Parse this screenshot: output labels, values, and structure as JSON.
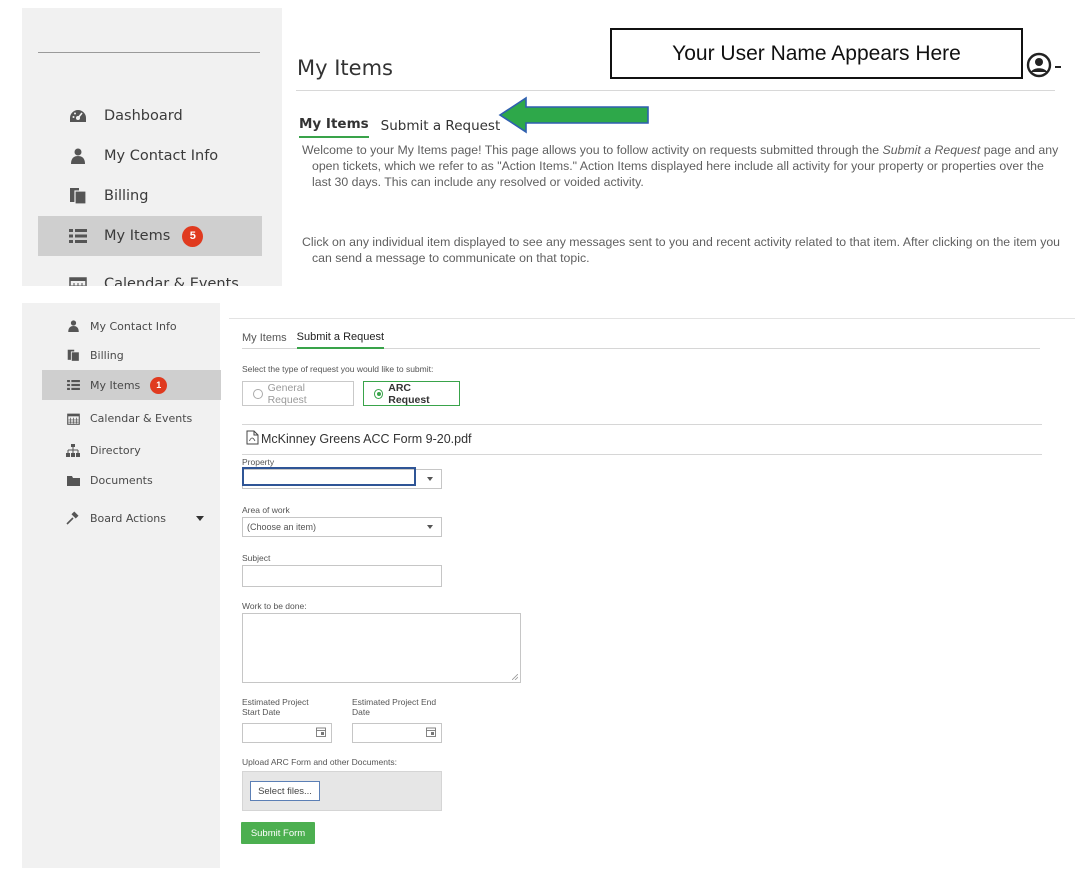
{
  "top": {
    "sidebar": {
      "items": [
        {
          "label": "Dashboard",
          "icon": "tachometer-icon"
        },
        {
          "label": "My Contact Info",
          "icon": "user-icon"
        },
        {
          "label": "Billing",
          "icon": "billing-icon"
        },
        {
          "label": "My Items",
          "icon": "list-icon",
          "badge": "5"
        },
        {
          "label": "Calendar & Events",
          "icon": "calendar-icon"
        }
      ]
    },
    "page_title": "My Items",
    "username_callout": "Your User Name Appears Here",
    "tabs": [
      {
        "label": "My Items",
        "active": true
      },
      {
        "label": "Submit a Request",
        "active": false
      }
    ],
    "intro": {
      "p1_a": "Welcome to your My Items page! This page allows you to follow activity on requests submitted through the ",
      "p1_em": "Submit a Request",
      "p1_b": " page and any open tickets, which we refer to as \"Action Items.\"  Action Items displayed here include all activity for your property or properties over the last 30 days.  This can include any resolved or voided activity.",
      "p2": "Click on any individual item displayed to see any messages sent to you and recent activity related to that item. After clicking on the item you can send a message to communicate on that topic."
    },
    "arrow_color": "#2ea84a"
  },
  "bottom": {
    "sidebar": {
      "items": [
        {
          "label": "My Contact Info",
          "icon": "user-icon"
        },
        {
          "label": "Billing",
          "icon": "billing-icon"
        },
        {
          "label": "My Items",
          "icon": "list-icon",
          "badge": "1"
        },
        {
          "label": "Calendar & Events",
          "icon": "calendar-icon"
        },
        {
          "label": "Directory",
          "icon": "sitemap-icon"
        },
        {
          "label": "Documents",
          "icon": "folder-icon"
        },
        {
          "label": "Board Actions",
          "icon": "gavel-icon"
        }
      ]
    },
    "tabs": [
      {
        "label": "My Items",
        "active": false
      },
      {
        "label": "Submit a Request",
        "active": true
      }
    ],
    "form": {
      "type_prompt": "Select the type of request you would like to submit:",
      "type_options": [
        {
          "label": "General Request",
          "selected": false
        },
        {
          "label": "ARC Request",
          "selected": true
        }
      ],
      "attachment_name": "McKinney Greens ACC Form 9-20.pdf",
      "property_label": "Property",
      "property_value": "",
      "area_label": "Area of work",
      "area_value": "(Choose an item)",
      "subject_label": "Subject",
      "work_label": "Work to be done:",
      "start_label": "Estimated Project Start Date",
      "end_label": "Estimated Project End Date",
      "upload_label": "Upload ARC Form and other Documents:",
      "select_files_label": "Select files...",
      "submit_label": "Submit Form"
    }
  },
  "colors": {
    "accent_green": "#39a34a",
    "badge_red": "#e03a1f",
    "sidebar_bg": "#f1f1f1",
    "active_item_bg": "#cfcfcf"
  }
}
